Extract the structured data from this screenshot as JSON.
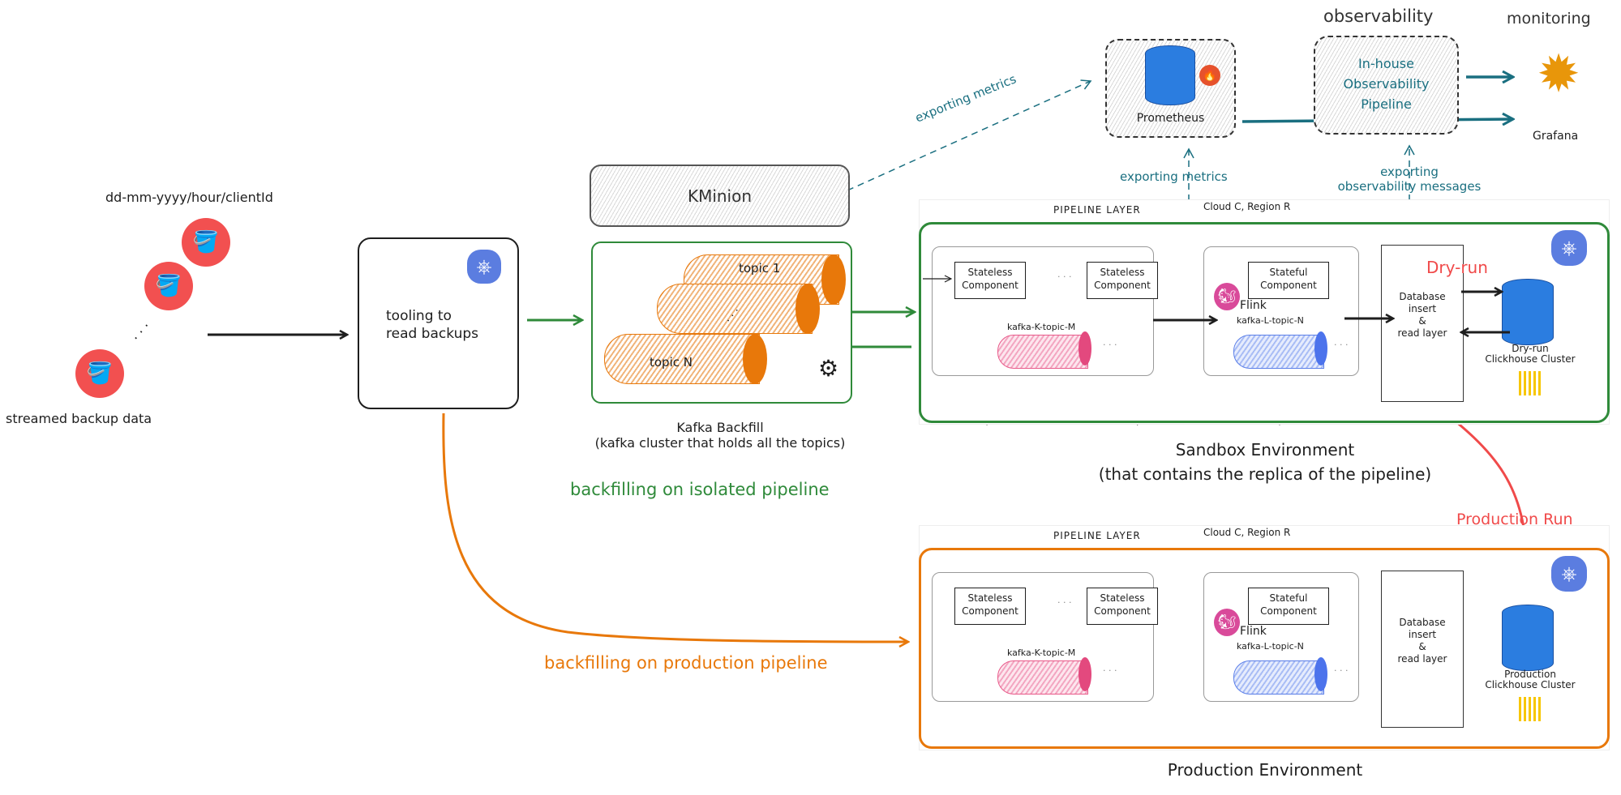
{
  "sources": {
    "path_label": "dd-mm-yyyy/hour/clientId",
    "caption": "streamed backup data",
    "bucket_icon": "s3-bucket-icon",
    "bucket_color": "#f25050",
    "ellipsis": ". . ."
  },
  "tooling": {
    "label_line1": "tooling to",
    "label_line2": "read backups",
    "icon": "kubernetes-icon"
  },
  "kminion": {
    "label": "KMinion"
  },
  "kafka_backfill": {
    "topic_first": "topic 1",
    "topic_last": "topic N",
    "ellipsis": ". . .",
    "title": "Kafka Backfill",
    "subtitle": "(kafka cluster that holds all the topics)",
    "icon": "kafka-icon",
    "color": "#e8780a"
  },
  "flows": {
    "isolated": {
      "label": "backfilling on isolated pipeline",
      "color": "#2f8a3a"
    },
    "production": {
      "label": "backfilling on production pipeline",
      "color": "#e8780a"
    },
    "exporting_metrics_kminion": "exporting metrics",
    "exporting_metrics_pipeline": "exporting metrics",
    "exporting_observability_line1": "exporting",
    "exporting_observability_line2": "observability messages",
    "teal": "#1a6f80",
    "dry_run": "Dry-run",
    "production_run": "Production Run",
    "red": "#f04a4a"
  },
  "observability": {
    "prometheus_label": "Prometheus",
    "observability_heading": "observability",
    "pipeline_line1": "In-house",
    "pipeline_line2": "Observability",
    "pipeline_line3": "Pipeline",
    "monitoring_heading": "monitoring",
    "grafana_label": "Grafana"
  },
  "environments": [
    {
      "id": "sandbox",
      "layer_label": "PIPELINE LAYER",
      "cloud_label": "Cloud C, Region R",
      "stateless_1": "Stateless Component",
      "stateless_2": "Stateless Component",
      "stateful": "Stateful Component",
      "flink_label": "Flink",
      "topic_k": "kafka-K-topic-M",
      "topic_l": "kafka-L-topic-N",
      "db_layer_1": "Database",
      "db_layer_2": "insert",
      "db_layer_3": "&",
      "db_layer_4": "read layer",
      "cluster_1": "Dry-run",
      "cluster_2": "Clickhouse Cluster",
      "title": "Sandbox Environment",
      "subtitle": "(that contains the replica of the pipeline)",
      "frame_color": "#2f8a3a"
    },
    {
      "id": "production",
      "layer_label": "PIPELINE LAYER",
      "cloud_label": "Cloud C, Region R",
      "stateless_1": "Stateless Component",
      "stateless_2": "Stateless Component",
      "stateful": "Stateful Component",
      "flink_label": "Flink",
      "topic_k": "kafka-K-topic-M",
      "topic_l": "kafka-L-topic-N",
      "db_layer_1": "Database",
      "db_layer_2": "insert",
      "db_layer_3": "&",
      "db_layer_4": "read layer",
      "cluster_1": "Production",
      "cluster_2": "Clickhouse Cluster",
      "title": "Production Environment",
      "subtitle": "",
      "frame_color": "#e8780a"
    }
  ],
  "misc": {
    "dots": "· · ·"
  }
}
